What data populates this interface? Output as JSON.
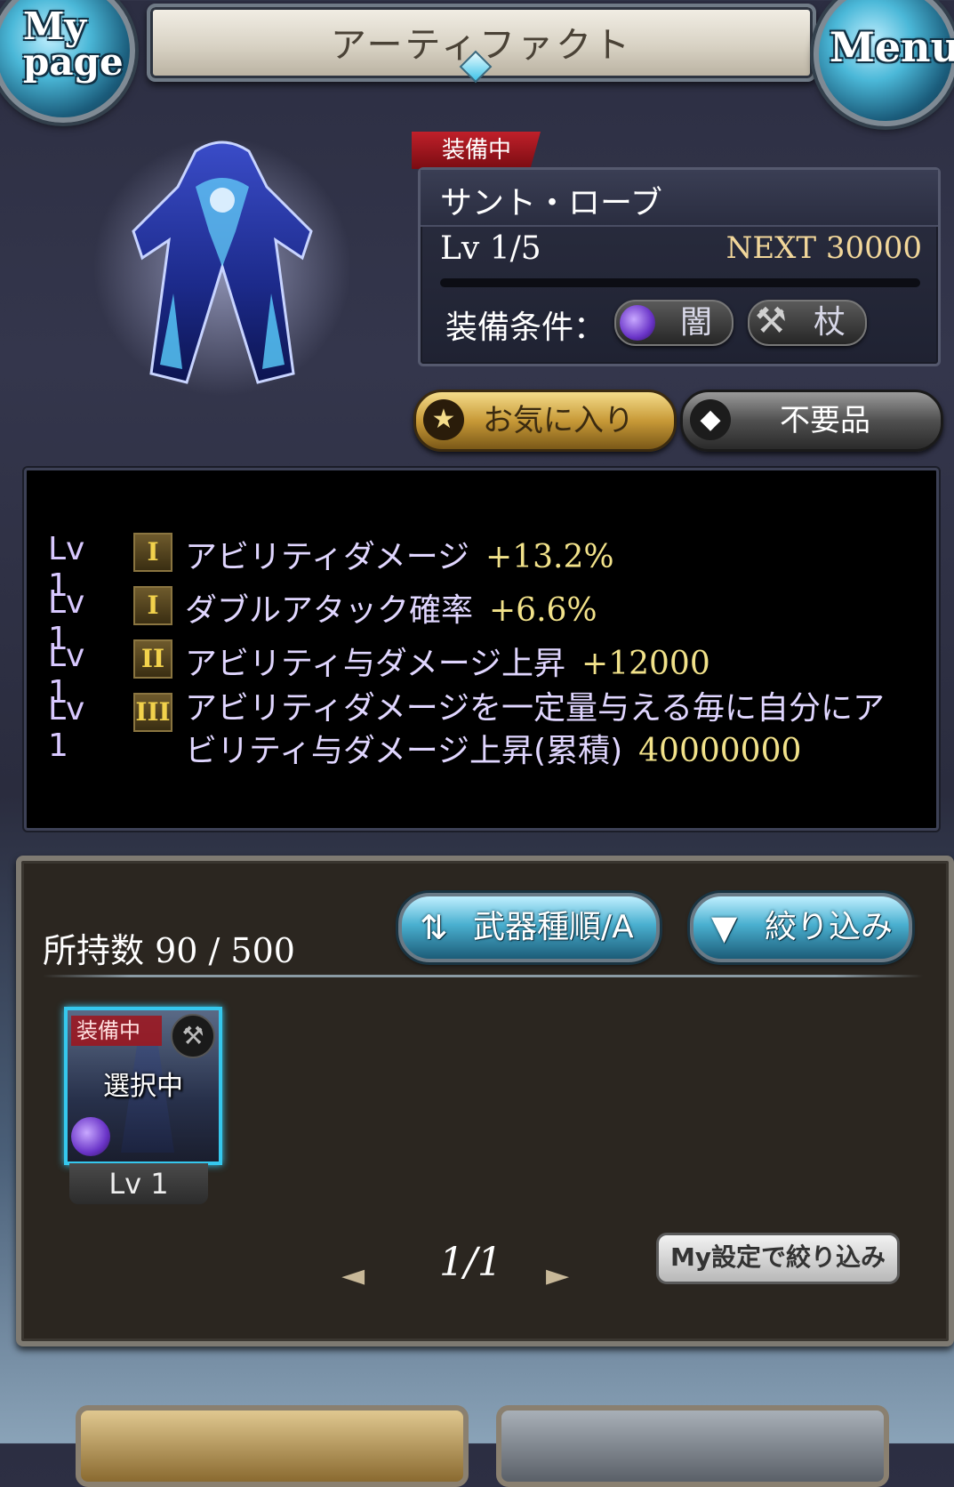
{
  "header": {
    "title": "アーティファクト",
    "mypage_label": "My\npage",
    "menu_label": "Menu"
  },
  "artifact": {
    "equipped_badge": "装備中",
    "name": "サント・ローブ",
    "level": "Lv 1/5",
    "next": "NEXT 30000",
    "exp_progress": 0.0,
    "condition_label": "装備条件：",
    "condition_element": "闇",
    "condition_weapon": "杖"
  },
  "actions": {
    "favorite": "お気に入り",
    "unneeded": "不要品"
  },
  "skills": [
    {
      "level": "Lv 1",
      "rank": "I",
      "name": "アビリティダメージ",
      "value": "+13.2%"
    },
    {
      "level": "Lv 1",
      "rank": "I",
      "name": "ダブルアタック確率",
      "value": "+6.6%"
    },
    {
      "level": "Lv 1",
      "rank": "II",
      "name": "アビリティ与ダメージ上昇",
      "value": "+12000"
    },
    {
      "level": "Lv 1",
      "rank": "III",
      "name": "アビリティダメージを一定量与える毎に自分にアビリティ与ダメージ上昇(累積)",
      "value": "40000000"
    }
  ],
  "inventory": {
    "owned_label": "所持数",
    "owned_count": "90 / 500",
    "sort_button": "武器種順/A",
    "filter_button": "絞り込み",
    "items": [
      {
        "equipped_tag": "装備中",
        "selected_label": "選択中",
        "level": "Lv 1"
      }
    ],
    "pager": "1/1",
    "my_filter_button": "My設定で絞り込み"
  },
  "colors": {
    "accent_cyan": "#35c8ee",
    "value_gold": "#f2e28a",
    "equipped_red": "#c0202a"
  }
}
